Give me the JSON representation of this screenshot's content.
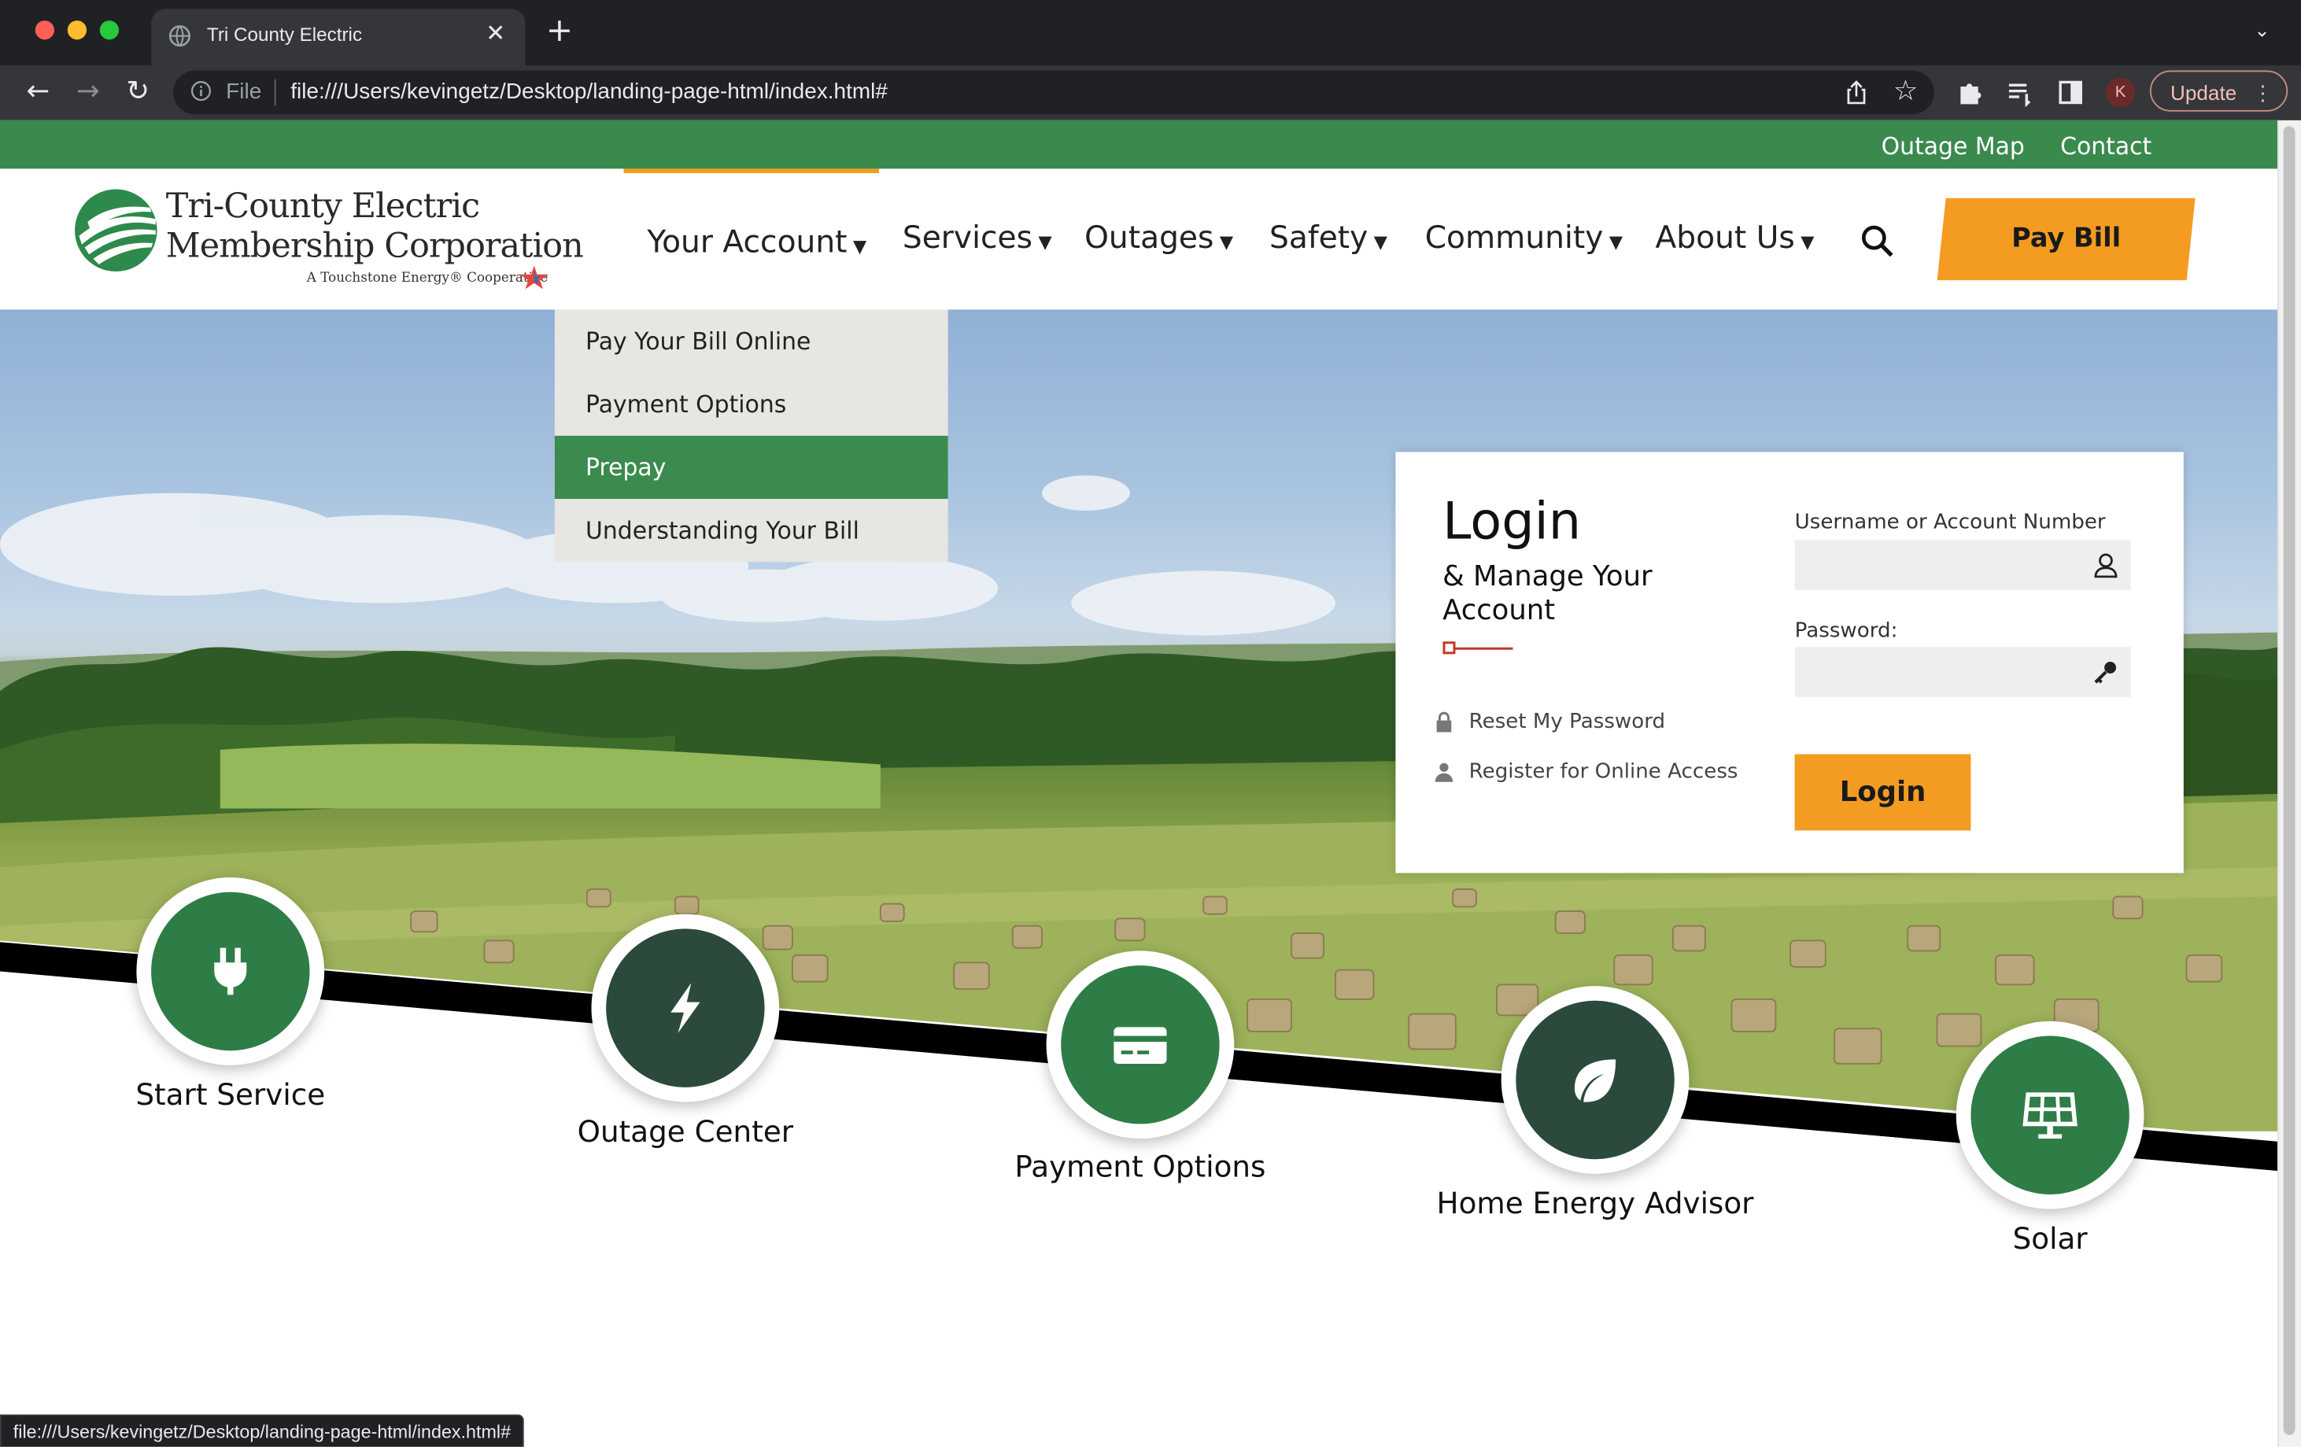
{
  "browser": {
    "tab_title": "Tri County Electric",
    "url_scheme": "File",
    "url": "file:///Users/kevingetz/Desktop/landing-page-html/index.html#",
    "profile_initial": "K",
    "update_label": "Update",
    "status_url": "file:///Users/kevingetz/Desktop/landing-page-html/index.html#"
  },
  "utility": {
    "outage_map": "Outage Map",
    "contact": "Contact"
  },
  "logo": {
    "line1": "Tri-County Electric",
    "line2": "Membership Corporation",
    "tagline": "A Touchstone Energy® Cooperative"
  },
  "nav": {
    "items": [
      {
        "label": "Your Account"
      },
      {
        "label": "Services"
      },
      {
        "label": "Outages"
      },
      {
        "label": "Safety"
      },
      {
        "label": "Community"
      },
      {
        "label": "About Us"
      }
    ],
    "pay_bill": "Pay Bill"
  },
  "dropdown": {
    "items": [
      {
        "label": "Pay Your Bill Online"
      },
      {
        "label": "Payment Options"
      },
      {
        "label": "Prepay",
        "active": true
      },
      {
        "label": "Understanding Your Bill"
      }
    ]
  },
  "login": {
    "title": "Login",
    "subtitle": "& Manage Your Account",
    "reset_link": "Reset My Password",
    "register_link": "Register for Online Access",
    "username_label": "Username or Account Number",
    "password_label": "Password:",
    "button": "Login"
  },
  "services": [
    {
      "label": "Start Service",
      "icon": "plug-icon",
      "color": "#2e7d46"
    },
    {
      "label": "Outage Center",
      "icon": "lightning-icon",
      "color": "#2b4a3c"
    },
    {
      "label": "Payment Options",
      "icon": "credit-card-icon",
      "color": "#2e7d46"
    },
    {
      "label": "Home Energy Advisor",
      "icon": "leaf-icon",
      "color": "#2b4a3c"
    },
    {
      "label": "Solar",
      "icon": "solar-panel-icon",
      "color": "#2e7d46"
    }
  ],
  "colors": {
    "brand_green": "#3a8a4e",
    "accent_orange": "#f49c22",
    "dark_green": "#2b4a3c"
  }
}
